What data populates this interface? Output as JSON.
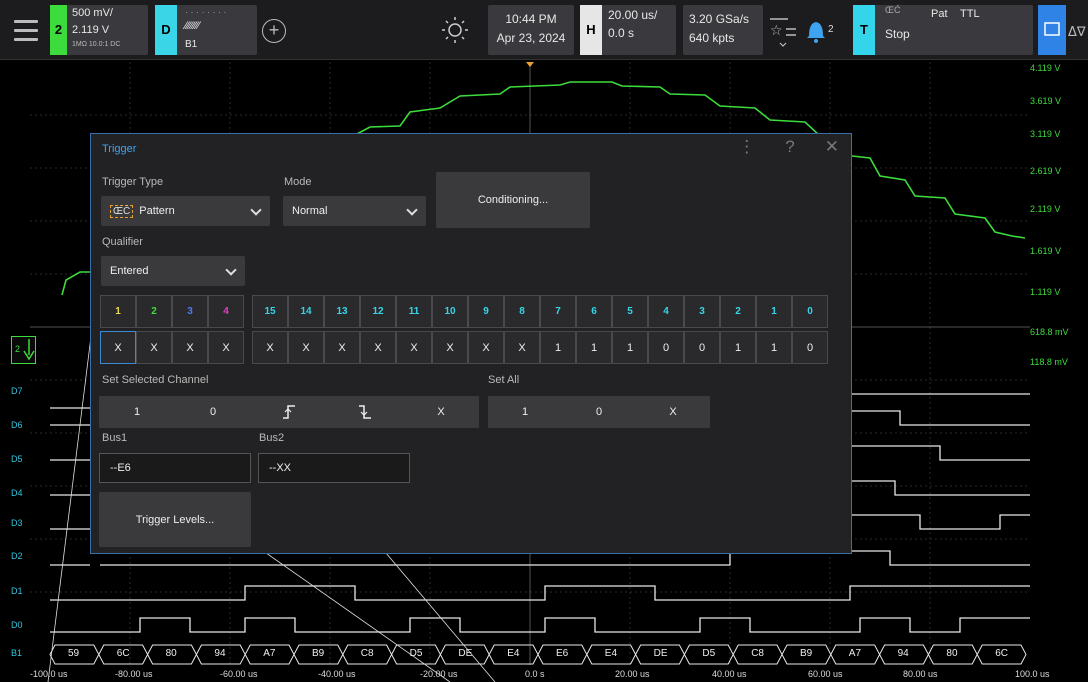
{
  "toolbar": {
    "ch2": {
      "num": "2",
      "scale": "500 mV/",
      "offset": "2.119 V",
      "info": "1MΩ  10.0:1  DC"
    },
    "digital": {
      "num": "D",
      "pattern": "⁄⁄⁄⁄⁄⁄⁄⁄",
      "bus": "B1"
    },
    "time": "10:44 PM",
    "date": "Apr 23, 2024",
    "horizontal": {
      "label": "H",
      "scale": "20.00 us/",
      "delay": "0.0 s"
    },
    "acquisition": {
      "rate": "3.20 GSa/s",
      "points": "640 kpts"
    },
    "alerts": "2",
    "trigger": {
      "label": "T",
      "state": "Stop",
      "type": "Pat",
      "level": "TTL"
    }
  },
  "scope": {
    "volt_labels": [
      "4.119 V",
      "3.619 V",
      "3.119 V",
      "2.619 V",
      "2.119 V",
      "1.619 V",
      "1.119 V",
      "618.8 mV",
      "118.8 mV"
    ],
    "digital_labels": [
      "D7",
      "D6",
      "D5",
      "D4",
      "D3",
      "D2",
      "D1",
      "D0",
      "B1"
    ],
    "ch2_marker": "2",
    "time_labels": [
      "-100.0 us",
      "-80.00 us",
      "-60.00 us",
      "-40.00 us",
      "-20.00 us",
      "0.0 s",
      "20.00 us",
      "40.00 us",
      "60.00 us",
      "80.00 us",
      "100.0 us"
    ],
    "bus_values": [
      "59",
      "6C",
      "80",
      "94",
      "A7",
      "B9",
      "C8",
      "D5",
      "DE",
      "E4",
      "E6",
      "E4",
      "DE",
      "D5",
      "C8",
      "B9",
      "A7",
      "94",
      "80",
      "6C"
    ],
    "colors": {
      "analog": "#3ddc3d",
      "digital": "#e8e8e8",
      "accent": "#3ea4f0"
    }
  },
  "dialog": {
    "title": "Trigger",
    "trigger_type_label": "Trigger Type",
    "trigger_type": "Pattern",
    "mode_label": "Mode",
    "mode": "Normal",
    "conditioning": "Conditioning...",
    "qualifier_label": "Qualifier",
    "qualifier": "Entered",
    "channels": [
      {
        "label": "1",
        "color": "#e8d84a",
        "value": "X"
      },
      {
        "label": "2",
        "color": "#3ddc3d",
        "value": "X"
      },
      {
        "label": "3",
        "color": "#4a7cf0",
        "value": "X"
      },
      {
        "label": "4",
        "color": "#e040c0",
        "value": "X"
      },
      {
        "label": "15",
        "color": "#34d5ea",
        "value": "X"
      },
      {
        "label": "14",
        "color": "#34d5ea",
        "value": "X"
      },
      {
        "label": "13",
        "color": "#34d5ea",
        "value": "X"
      },
      {
        "label": "12",
        "color": "#34d5ea",
        "value": "X"
      },
      {
        "label": "11",
        "color": "#34d5ea",
        "value": "X"
      },
      {
        "label": "10",
        "color": "#34d5ea",
        "value": "X"
      },
      {
        "label": "9",
        "color": "#34d5ea",
        "value": "X"
      },
      {
        "label": "8",
        "color": "#34d5ea",
        "value": "X"
      },
      {
        "label": "7",
        "color": "#34d5ea",
        "value": "1"
      },
      {
        "label": "6",
        "color": "#34d5ea",
        "value": "1"
      },
      {
        "label": "5",
        "color": "#34d5ea",
        "value": "1"
      },
      {
        "label": "4",
        "color": "#34d5ea",
        "value": "0"
      },
      {
        "label": "3",
        "color": "#34d5ea",
        "value": "0"
      },
      {
        "label": "2",
        "color": "#34d5ea",
        "value": "1"
      },
      {
        "label": "1",
        "color": "#34d5ea",
        "value": "1"
      },
      {
        "label": "0",
        "color": "#34d5ea",
        "value": "0"
      }
    ],
    "set_selected_label": "Set Selected Channel",
    "set_selected": [
      "1",
      "0",
      "rising",
      "falling",
      "X"
    ],
    "set_all_label": "Set All",
    "set_all": [
      "1",
      "0",
      "X"
    ],
    "bus1_label": "Bus1",
    "bus1": "--E6",
    "bus2_label": "Bus2",
    "bus2": "--XX",
    "trigger_levels": "Trigger Levels..."
  }
}
